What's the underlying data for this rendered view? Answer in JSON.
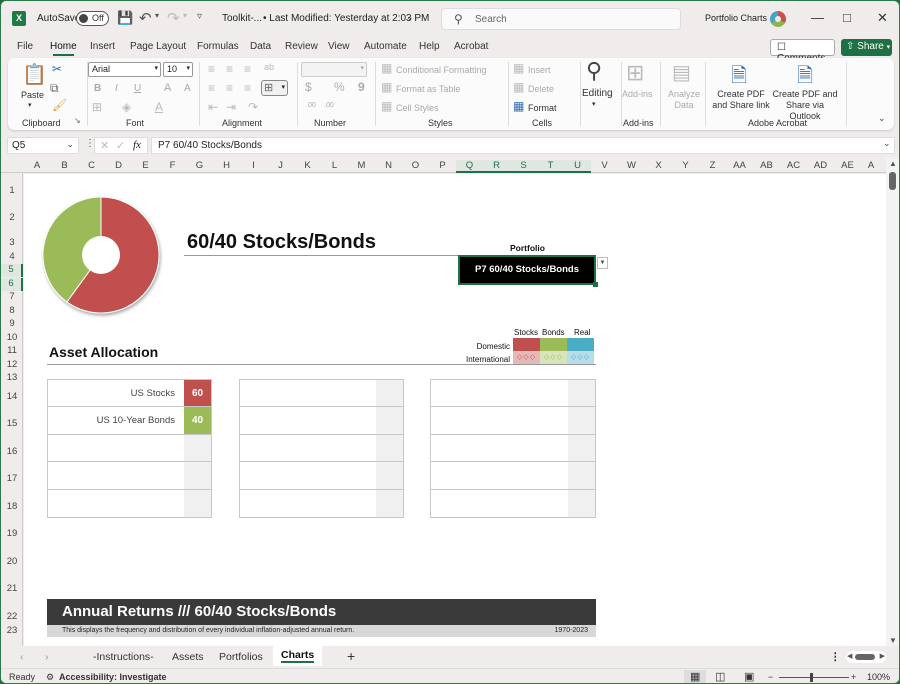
{
  "titlebar": {
    "app_logo": "X",
    "autosave_label": "AutoSave",
    "autosave_state": "Off",
    "filename": "Toolkit-...",
    "last_modified": "• Last Modified: Yesterday at 2:03 PM",
    "search_placeholder": "Search",
    "account_name": "Portfolio Charts",
    "icons": [
      "save-icon",
      "undo-icon",
      "redo-icon",
      "customize-qat-icon",
      "minimize-icon",
      "maximize-icon",
      "close-icon"
    ]
  },
  "menu": {
    "items": [
      "File",
      "Home",
      "Insert",
      "Page Layout",
      "Formulas",
      "Data",
      "Review",
      "View",
      "Automate",
      "Help",
      "Acrobat"
    ],
    "active": "Home",
    "comments_label": "Comments",
    "share_label": "Share"
  },
  "ribbon": {
    "clipboard": {
      "label": "Clipboard",
      "paste": "Paste"
    },
    "font": {
      "label": "Font",
      "family": "Arial",
      "size": "10",
      "bold": "B",
      "italic": "I",
      "underline": "U",
      "grow": "A",
      "shrink": "A"
    },
    "alignment": {
      "label": "Alignment"
    },
    "number": {
      "label": "Number",
      "format": "",
      "currency": "$",
      "percent": "%",
      "comma": "9",
      "inc_dec": ".00"
    },
    "styles": {
      "label": "Styles",
      "conditional": "Conditional Formatting",
      "format_table": "Format as Table",
      "cell_styles": "Cell Styles"
    },
    "cells": {
      "label": "Cells",
      "insert": "Insert",
      "delete": "Delete",
      "format": "Format"
    },
    "editing": {
      "label": "Editing"
    },
    "addins": {
      "label": "Add-ins",
      "addins": "Add-ins",
      "analyze": "Analyze Data"
    },
    "acrobat": {
      "label": "Adobe Acrobat",
      "pdf_link": "Create PDF and Share link",
      "pdf_outlook": "Create PDF and Share via Outlook"
    }
  },
  "formula_bar": {
    "name_box": "Q5",
    "fx": "fx",
    "formula": "P7  60/40 Stocks/Bonds"
  },
  "grid": {
    "columns": [
      "A",
      "B",
      "C",
      "D",
      "E",
      "F",
      "G",
      "H",
      "I",
      "J",
      "K",
      "L",
      "M",
      "N",
      "O",
      "P",
      "Q",
      "R",
      "S",
      "T",
      "U",
      "V",
      "W",
      "X",
      "Y",
      "Z",
      "AA",
      "AB",
      "AC",
      "AD",
      "AE",
      "A"
    ],
    "selected_columns": [
      "Q",
      "R",
      "S",
      "T",
      "U"
    ],
    "rows": [
      "1",
      "2",
      "3",
      "4",
      "5",
      "6",
      "7",
      "8",
      "9",
      "10",
      "11",
      "12",
      "13",
      "14",
      "15",
      "16",
      "17",
      "18",
      "19",
      "20",
      "21",
      "22",
      "23"
    ],
    "selected_rows": [
      "5",
      "6"
    ]
  },
  "sheet": {
    "title": "60/40 Stocks/Bonds",
    "portfolio_label": "Portfolio",
    "portfolio_value": "P7  60/40 Stocks/Bonds",
    "donut": {
      "slices": [
        {
          "name": "US Stocks",
          "value": 60,
          "color": "#c0504d"
        },
        {
          "name": "US 10-Year Bonds",
          "value": 40,
          "color": "#9bbb59"
        }
      ]
    },
    "asset_allocation_title": "Asset Allocation",
    "legend": {
      "columns": [
        "Stocks",
        "Bonds",
        "Real"
      ],
      "rows": [
        "Domestic",
        "International"
      ],
      "colors": {
        "stocks": "#c0504d",
        "bonds": "#9bbb59",
        "real": "#4bacc6",
        "stocks_intl": "#e6b8b7",
        "bonds_intl": "#d7e4bc",
        "real_intl": "#b7dee8"
      },
      "intl_pattern": "◇◇◇"
    },
    "allocation_tables": [
      {
        "rows": [
          {
            "label": "US Stocks",
            "value": "60",
            "color": "#c0504d"
          },
          {
            "label": "US 10-Year Bonds",
            "value": "40",
            "color": "#9bbb59"
          },
          {
            "label": "",
            "value": "",
            "color": ""
          },
          {
            "label": "",
            "value": "",
            "color": ""
          },
          {
            "label": "",
            "value": "",
            "color": ""
          }
        ]
      },
      {
        "rows": [
          {
            "label": "",
            "value": "",
            "color": ""
          },
          {
            "label": "",
            "value": "",
            "color": ""
          },
          {
            "label": "",
            "value": "",
            "color": ""
          },
          {
            "label": "",
            "value": "",
            "color": ""
          },
          {
            "label": "",
            "value": "",
            "color": ""
          }
        ]
      },
      {
        "rows": [
          {
            "label": "",
            "value": "",
            "color": ""
          },
          {
            "label": "",
            "value": "",
            "color": ""
          },
          {
            "label": "",
            "value": "",
            "color": ""
          },
          {
            "label": "",
            "value": "",
            "color": ""
          },
          {
            "label": "",
            "value": "",
            "color": ""
          }
        ]
      }
    ],
    "annual_returns_title": "Annual Returns /// 60/40 Stocks/Bonds",
    "annual_returns_desc": "This displays the frequency and distribution of every individual inflation-adjusted annual return.",
    "annual_returns_years": "1970-2023"
  },
  "sheet_tabs": {
    "tabs": [
      "-Instructions-",
      "Assets",
      "Portfolios",
      "Charts"
    ],
    "active": "Charts",
    "add": "+"
  },
  "status_bar": {
    "ready": "Ready",
    "accessibility": "Accessibility: Investigate",
    "zoom": "100%"
  }
}
